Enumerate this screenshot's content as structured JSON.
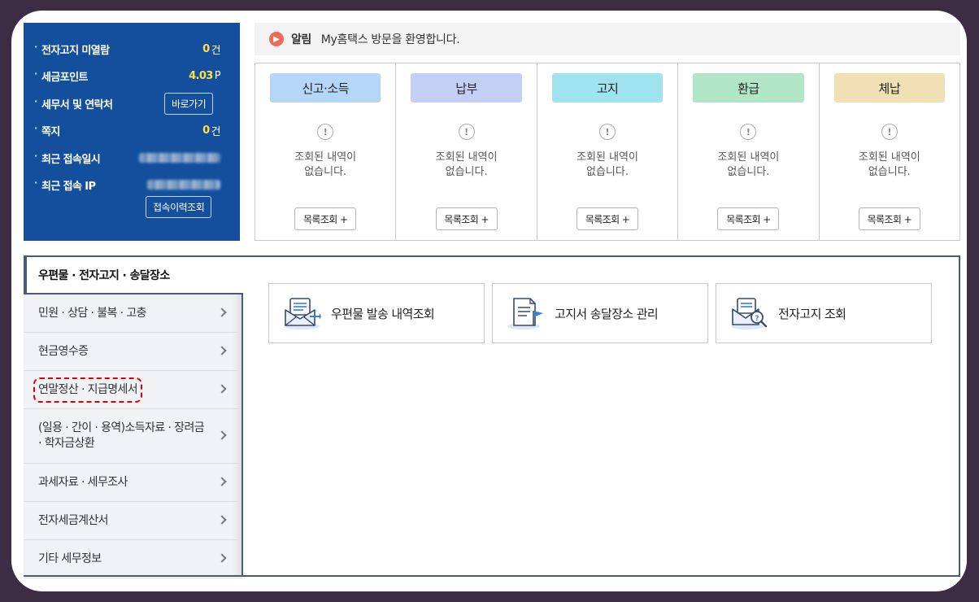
{
  "info": {
    "unread_label": "전자고지 미열람",
    "unread_value": "0",
    "unread_unit": "건",
    "points_label": "세금포인트",
    "points_value": "4.03",
    "points_unit": "P",
    "office_label": "세무서 및 연락처",
    "office_button": "바로가기",
    "memo_label": "쪽지",
    "memo_value": "0",
    "memo_unit": "건",
    "last_login_label": "최근 접속일시",
    "last_ip_label": "최근 접속 IP",
    "history_button": "접속이력조회"
  },
  "notice": {
    "label": "알림",
    "message": "My홈택스 방문을 환영합니다."
  },
  "cards": [
    {
      "title": "신고·소득",
      "color": "#b6d6f8",
      "msg1": "조회된 내역이",
      "msg2": "없습니다.",
      "button": "목록조회 +"
    },
    {
      "title": "납부",
      "color": "#c4cff6",
      "msg1": "조회된 내역이",
      "msg2": "없습니다.",
      "button": "목록조회 +"
    },
    {
      "title": "고지",
      "color": "#9fe3ee",
      "msg1": "조회된 내역이",
      "msg2": "없습니다.",
      "button": "목록조회 +"
    },
    {
      "title": "환급",
      "color": "#b2e6c8",
      "msg1": "조회된 내역이",
      "msg2": "없습니다.",
      "button": "목록조회 +"
    },
    {
      "title": "체납",
      "color": "#f1e0b4",
      "msg1": "조회된 내역이",
      "msg2": "없습니다.",
      "button": "목록조회 +"
    }
  ],
  "section": {
    "title": "우편물 · 전자고지 · 송달장소"
  },
  "menu": [
    {
      "label": "민원 · 상담 · 불복 · 고충"
    },
    {
      "label": "현금영수증"
    },
    {
      "label": "연말정산 · 지급명세서"
    },
    {
      "label": "(일용 · 간이 · 용역)소득자료 · 장려금 · 학자금상환"
    },
    {
      "label": "과세자료 · 세무조사"
    },
    {
      "label": "전자세금계산서"
    },
    {
      "label": "기타 세무정보"
    }
  ],
  "features": [
    {
      "label": "우편물 발송 내역조회",
      "icon": "mail-list-icon"
    },
    {
      "label": "고지서 송달장소 관리",
      "icon": "document-flag-icon"
    },
    {
      "label": "전자고지 조회",
      "icon": "mail-search-icon"
    }
  ]
}
